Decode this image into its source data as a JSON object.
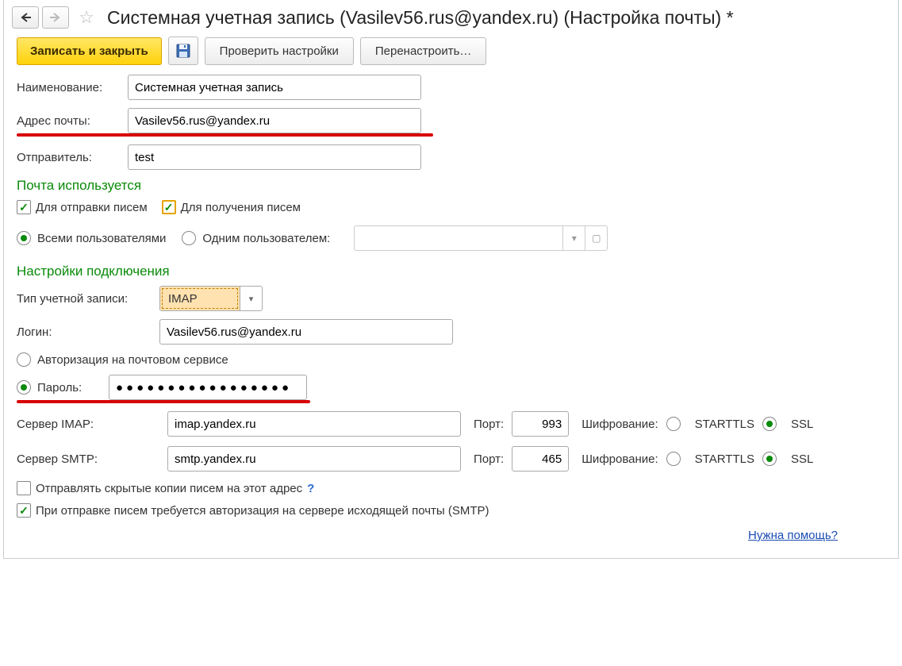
{
  "title": "Системная учетная запись (Vasilev56.rus@yandex.ru) (Настройка почты) *",
  "toolbar": {
    "save_close": "Записать и закрыть",
    "check": "Проверить настройки",
    "reconfig": "Перенастроить…"
  },
  "fields": {
    "name_label": "Наименование:",
    "name_value": "Системная учетная запись",
    "email_label": "Адрес почты:",
    "email_value": "Vasilev56.rus@yandex.ru",
    "sender_label": "Отправитель:",
    "sender_value": "test"
  },
  "usage": {
    "header": "Почта используется",
    "for_send": "Для отправки писем",
    "for_receive": "Для получения писем",
    "all_users": "Всеми пользователями",
    "one_user": "Одним пользователем:"
  },
  "conn": {
    "header": "Настройки подключения",
    "acct_type_label": "Тип учетной записи:",
    "acct_type_value": "IMAP",
    "login_label": "Логин:",
    "login_value": "Vasilev56.rus@yandex.ru",
    "auth_service": "Авторизация на почтовом сервисе",
    "password_label": "Пароль:",
    "password_value": "●●●●●●●●●●●●●●●●●",
    "imap_label": "Сервер IMAP:",
    "imap_value": "imap.yandex.ru",
    "smtp_label": "Сервер SMTP:",
    "smtp_value": "smtp.yandex.ru",
    "port_label": "Порт:",
    "imap_port": "993",
    "smtp_port": "465",
    "enc_label": "Шифрование:",
    "starttls": "STARTTLS",
    "ssl": "SSL"
  },
  "options": {
    "bcc": "Отправлять скрытые копии писем на этот адрес",
    "smtp_auth": "При отправке писем требуется авторизация на сервере исходящей почты (SMTP)"
  },
  "help_link": "Нужна помощь?"
}
